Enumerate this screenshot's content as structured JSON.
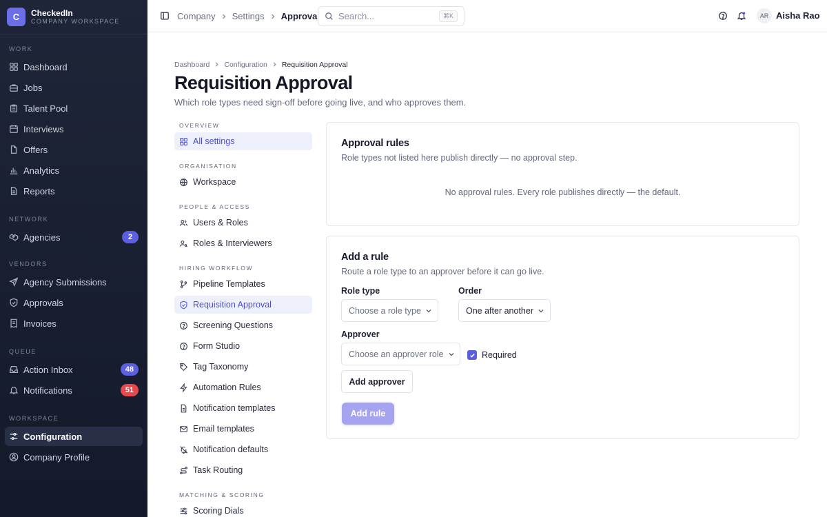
{
  "app": {
    "name": "CheckedIn",
    "workspace_label": "COMPANY WORKSPACE",
    "logo_letter": "C",
    "accent_color": "#5a5de0"
  },
  "sidebar": {
    "sections": [
      {
        "title": "WORK",
        "items": [
          {
            "label": "Dashboard",
            "icon": "grid-icon"
          },
          {
            "label": "Jobs",
            "icon": "briefcase-icon"
          },
          {
            "label": "Talent Pool",
            "icon": "clipboard-icon"
          },
          {
            "label": "Interviews",
            "icon": "calendar-icon"
          },
          {
            "label": "Offers",
            "icon": "document-icon"
          },
          {
            "label": "Analytics",
            "icon": "bar-chart-icon"
          },
          {
            "label": "Reports",
            "icon": "report-icon"
          }
        ]
      },
      {
        "title": "NETWORK",
        "items": [
          {
            "label": "Agencies",
            "icon": "handshake-icon",
            "badge": "2"
          }
        ]
      },
      {
        "title": "VENDORS",
        "items": [
          {
            "label": "Agency Submissions",
            "icon": "send-icon"
          },
          {
            "label": "Approvals",
            "icon": "shield-check-icon"
          },
          {
            "label": "Invoices",
            "icon": "receipt-icon"
          }
        ]
      },
      {
        "title": "QUEUE",
        "items": [
          {
            "label": "Action Inbox",
            "icon": "inbox-icon",
            "badge": "48"
          },
          {
            "label": "Notifications",
            "icon": "bell-icon",
            "badge": "51"
          }
        ]
      },
      {
        "title": "WORKSPACE",
        "items": [
          {
            "label": "Configuration",
            "icon": "sliders-icon"
          },
          {
            "label": "Company Profile",
            "icon": "user-circle-icon"
          }
        ]
      }
    ],
    "active_item": "Configuration"
  },
  "topbar": {
    "breadcrumb": [
      "Company",
      "Settings",
      "Approvals"
    ],
    "search_placeholder": "Search...",
    "search_shortcut": "⌘K",
    "user": {
      "initials": "AR",
      "name": "Aisha Rao"
    }
  },
  "page": {
    "breadcrumb": [
      "Dashboard",
      "Configuration",
      "Requisition Approval"
    ],
    "title": "Requisition Approval",
    "subtitle": "Which role types need sign-off before going live, and who approves them."
  },
  "settings_nav": {
    "groups": [
      {
        "title": "OVERVIEW",
        "items": [
          {
            "label": "All settings",
            "icon": "grid-icon"
          }
        ]
      },
      {
        "title": "ORGANISATION",
        "items": [
          {
            "label": "Workspace",
            "icon": "globe-icon"
          }
        ]
      },
      {
        "title": "PEOPLE & ACCESS",
        "items": [
          {
            "label": "Users & Roles",
            "icon": "users-icon"
          },
          {
            "label": "Roles & Interviewers",
            "icon": "user-key-icon"
          }
        ]
      },
      {
        "title": "HIRING WORKFLOW",
        "items": [
          {
            "label": "Pipeline Templates",
            "icon": "branch-icon"
          },
          {
            "label": "Requisition Approval",
            "icon": "shield-check-icon"
          },
          {
            "label": "Screening Questions",
            "icon": "help-circle-icon"
          },
          {
            "label": "Form Studio",
            "icon": "help-circle-icon"
          },
          {
            "label": "Tag Taxonomy",
            "icon": "tag-icon"
          },
          {
            "label": "Automation Rules",
            "icon": "bolt-icon"
          },
          {
            "label": "Notification templates",
            "icon": "file-text-icon"
          },
          {
            "label": "Email templates",
            "icon": "mail-icon"
          },
          {
            "label": "Notification defaults",
            "icon": "bell-off-icon"
          },
          {
            "label": "Task Routing",
            "icon": "route-icon"
          }
        ]
      },
      {
        "title": "MATCHING & SCORING",
        "items": [
          {
            "label": "Scoring Dials",
            "icon": "sliders-icon"
          }
        ]
      }
    ],
    "active_item": "Requisition Approval"
  },
  "approval_rules": {
    "title": "Approval rules",
    "subtitle": "Role types not listed here publish directly — no approval step.",
    "empty_text": "No approval rules. Every role publishes directly — the default."
  },
  "add_rule": {
    "title": "Add a rule",
    "subtitle": "Route a role type to an approver before it can go live.",
    "role_type_label": "Role type",
    "role_type_placeholder": "Choose a role type",
    "order_label": "Order",
    "order_value": "One after another",
    "approver_label": "Approver",
    "approver_placeholder": "Choose an approver role",
    "required_label": "Required",
    "required_checked": true,
    "add_approver_label": "Add approver",
    "add_rule_label": "Add rule"
  }
}
